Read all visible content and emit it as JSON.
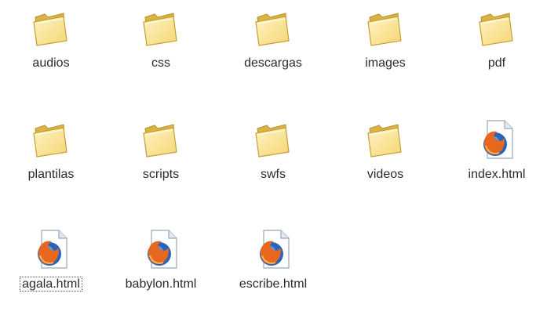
{
  "explorer": {
    "items": [
      {
        "name": "audios",
        "type": "folder"
      },
      {
        "name": "css",
        "type": "folder"
      },
      {
        "name": "descargas",
        "type": "folder"
      },
      {
        "name": "images",
        "type": "folder"
      },
      {
        "name": "pdf",
        "type": "folder"
      },
      {
        "name": "plantilas",
        "type": "folder"
      },
      {
        "name": "scripts",
        "type": "folder"
      },
      {
        "name": "swfs",
        "type": "folder"
      },
      {
        "name": "videos",
        "type": "folder"
      },
      {
        "name": "index.html",
        "type": "firefox-html"
      },
      {
        "name": "agala.html",
        "type": "firefox-html",
        "selected": true
      },
      {
        "name": "babylon.html",
        "type": "firefox-html"
      },
      {
        "name": "escribe.html",
        "type": "firefox-html"
      }
    ],
    "colors": {
      "folder": "#f4d675",
      "folder_dark": "#d9b443",
      "firefox_orange": "#e8671f",
      "firefox_blue": "#2b63b8"
    }
  }
}
